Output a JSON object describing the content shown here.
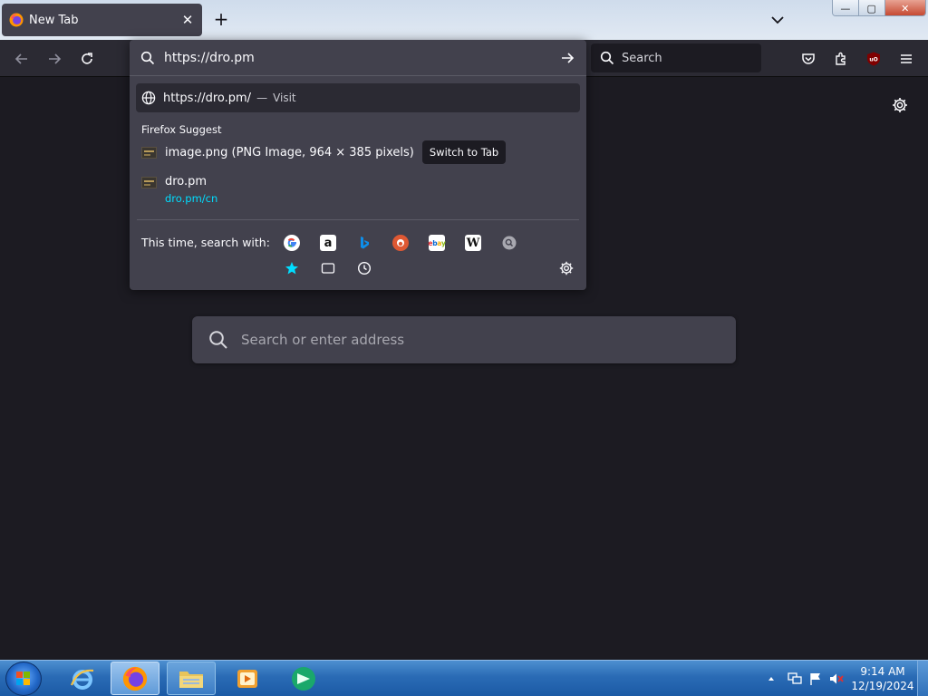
{
  "tab": {
    "title": "New Tab",
    "close": "✕"
  },
  "window_controls": {
    "minimize": "—",
    "maximize": "▢",
    "close": "✕"
  },
  "toolbar": {
    "search_placeholder": "Search"
  },
  "urlbar": {
    "value": "https://dro.pm",
    "visit_row": {
      "url": "https://dro.pm/",
      "separator": "—",
      "action": "Visit"
    },
    "suggest_heading": "Firefox Suggest",
    "suggestions": [
      {
        "title": "image.png (PNG Image, 964 × 385 pixels)",
        "action": "Switch to Tab"
      },
      {
        "title": "dro.pm",
        "url": "dro.pm/cn"
      }
    ],
    "search_with_label": "This time, search with:",
    "engines": [
      "Google",
      "Amazon",
      "Bing",
      "DuckDuckGo",
      "eBay",
      "Wikipedia",
      "Search"
    ],
    "modes": [
      "Bookmarks",
      "Tabs",
      "History"
    ]
  },
  "newtab": {
    "search_placeholder": "Search or enter address"
  },
  "taskbar": {
    "time": "9:14 AM",
    "date": "12/19/2024"
  },
  "colors": {
    "accent": "#00ddff",
    "panel": "#42414d",
    "page_bg": "#1c1b22",
    "toolbar": "#2b2a33"
  }
}
